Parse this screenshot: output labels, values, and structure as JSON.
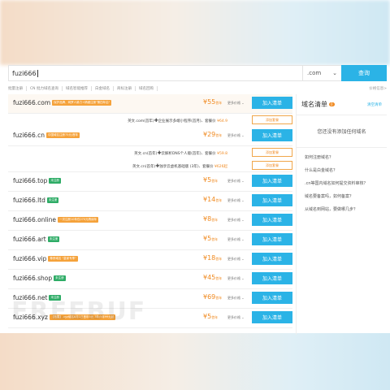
{
  "search": {
    "query": "fuzi666",
    "suffix": ".com",
    "button_label": "查询"
  },
  "subnav": {
    "items": [
      "批量注册",
      "CN 批力域名查询",
      "域名智能推荐",
      "白金域名",
      "商标注册",
      "域名回购"
    ],
    "right": "价格信息>"
  },
  "results": [
    {
      "domain": "fuzi666.com",
      "badge": "保护品牌、网罗人脉力+精细注册\"第四年启\"",
      "badge_color": "orange",
      "price": "¥55",
      "unit": "首年",
      "more": "更多价格",
      "add": "加入清单"
    },
    {
      "domain": "fuzi666.cn",
      "badge": "中国域名注册75元/首年",
      "badge_color": "orange",
      "price": "¥29",
      "unit": "首年",
      "more": "更多价格",
      "add": "加入清单"
    },
    {
      "domain": "fuzi666.top",
      "badge": "未注册",
      "badge_color": "green",
      "price": "¥5",
      "unit": "首年",
      "more": "更多价格",
      "add": "加入清单"
    },
    {
      "domain": "fuzi666.ltd",
      "badge": "未注册",
      "badge_color": "green",
      "price": "¥14",
      "unit": "首年",
      "more": "更多价格",
      "add": "加入清单"
    },
    {
      "domain": "fuzi666.online",
      "badge": "一次注册10年仅270元再续年",
      "badge_color": "orange",
      "price": "¥8",
      "unit": "首年",
      "more": "更多价格",
      "add": "加入清单"
    },
    {
      "domain": "fuzi666.art",
      "badge": "未注册",
      "badge_color": "green",
      "price": "¥5",
      "unit": "首年",
      "more": "更多价格",
      "add": "加入清单"
    },
    {
      "domain": "fuzi666.vip",
      "badge": "尊贵域名 \"皇家专享\"",
      "badge_color": "orange",
      "price": "¥18",
      "unit": "首年",
      "more": "更多价格",
      "add": "加入清单"
    },
    {
      "domain": "fuzi666.shop",
      "badge": "未注册",
      "badge_color": "green",
      "price": "¥45",
      "unit": "首年",
      "more": "更多价格",
      "add": "加入清单"
    },
    {
      "domain": "fuzi666.net",
      "badge": "未注册",
      "badge_color": "green",
      "price": "¥69",
      "unit": "首年",
      "more": "更多价格",
      "add": "加入清单"
    },
    {
      "domain": "fuzi666.xyz",
      "badge": "【拓展】.xyz域名8月1日首年5元 3年/5年99元起",
      "badge_color": "orange",
      "price": "¥5",
      "unit": "首年",
      "more": "更多价格",
      "add": "加入清单"
    }
  ],
  "bundles": {
    "com": [
      {
        "text": "英文.com(首年)",
        "addon": "企业展示多端小程序(首月)、套餐价",
        "price": "¥64.9",
        "button": "添加套餐"
      }
    ],
    "cn": [
      {
        "text": "英文.cn(首年)",
        "addon": "云解析DNS个人版(首年)、套餐价",
        "price": "¥59.8",
        "button": "添加套餐"
      },
      {
        "text": "英文.cn(首年)",
        "addon": "独享云虚机基础版 (3年)、套餐价",
        "price": "¥626起",
        "button": "添加套餐"
      }
    ]
  },
  "cart": {
    "title": "域名清单",
    "count": "0",
    "clear": "清空清单",
    "empty": "您还没有添加任何域名",
    "faq": [
      "如何注册域名？",
      "什么是白金域名？",
      ".cn等国内域名如何提交资料审核？",
      "域名要备案吗，如何备案？",
      "从域名到网站，要做哪几步？"
    ]
  },
  "watermark": "FREEBUF"
}
